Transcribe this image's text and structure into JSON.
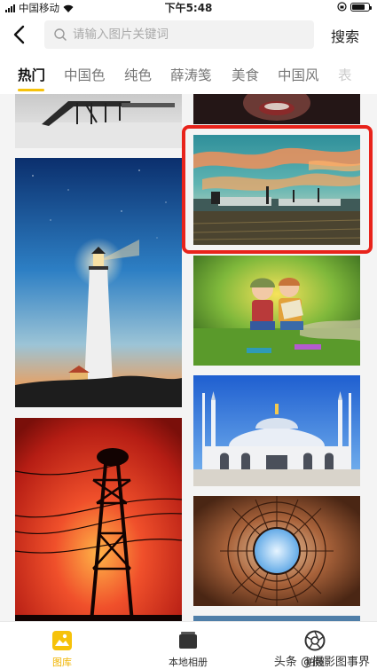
{
  "status_bar": {
    "carrier": "中国移动",
    "time": "下午5:48",
    "battery_level": 0.8
  },
  "search": {
    "placeholder": "请输入图片关键词",
    "button_label": "搜索"
  },
  "tabs": [
    {
      "label": "热门",
      "active": true
    },
    {
      "label": "中国色"
    },
    {
      "label": "纯色"
    },
    {
      "label": "薛涛笺"
    },
    {
      "label": "美食"
    },
    {
      "label": "中国风"
    },
    {
      "label": "表"
    }
  ],
  "gallery": {
    "images": [
      {
        "name": "pier-on-beach"
      },
      {
        "name": "dark-portrait-top"
      },
      {
        "name": "sunset-field-landscape",
        "highlighted": true
      },
      {
        "name": "lighthouse-at-dusk"
      },
      {
        "name": "children-reading-in-park"
      },
      {
        "name": "blue-mosque"
      },
      {
        "name": "electric-tower-red-sky"
      },
      {
        "name": "domed-ceiling-skylight"
      }
    ],
    "highlight_color": "#e8231b"
  },
  "bottom_nav": [
    {
      "label": "图库",
      "icon": "gallery-icon",
      "active": true
    },
    {
      "label": "本地相册",
      "icon": "album-icon"
    },
    {
      "label": "拍照",
      "icon": "camera-aperture-icon"
    }
  ],
  "watermark": "头条 @摄影图事界",
  "colors": {
    "accent": "#f6c20a",
    "active_nav": "#f0b400"
  }
}
